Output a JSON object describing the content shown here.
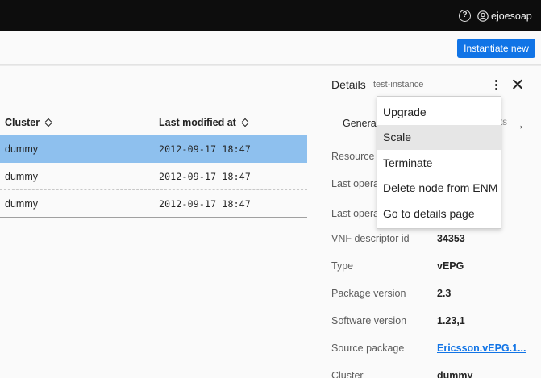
{
  "topbar": {
    "help_icon": "question-circle-icon",
    "user_icon": "user-icon",
    "username": "ejoesoap"
  },
  "actions": {
    "instantiate_label": "Instantiate new"
  },
  "table": {
    "columns": [
      {
        "label": "Cluster"
      },
      {
        "label": "Last modified at"
      }
    ],
    "rows": [
      {
        "cluster": "dummy",
        "modified": "2012-09-17 18:47",
        "selected": true
      },
      {
        "cluster": "dummy",
        "modified": "2012-09-17 18:47",
        "selected": false
      },
      {
        "cluster": "dummy",
        "modified": "2012-09-17 18:47",
        "selected": false
      }
    ]
  },
  "details": {
    "title": "Details",
    "subtitle": "test-instance",
    "tab_general": "Genera",
    "tab_partial": "ts",
    "fields": [
      {
        "label": "Resource i",
        "value": ""
      },
      {
        "label": "Last opera",
        "value": ""
      },
      {
        "label": "Last opera",
        "value": ""
      },
      {
        "label": "VNF descriptor id",
        "value": "34353"
      },
      {
        "label": "Type",
        "value": "vEPG"
      },
      {
        "label": "Package version",
        "value": "2.3"
      },
      {
        "label": "Software version",
        "value": "1.23,1"
      },
      {
        "label": "Source package",
        "value": "Ericsson.vEPG.1..."
      },
      {
        "label": "Cluster",
        "value": "dummy"
      }
    ]
  },
  "menu": {
    "items": [
      {
        "label": "Upgrade"
      },
      {
        "label": "Scale"
      },
      {
        "label": "Terminate"
      },
      {
        "label": "Delete node from ENM"
      },
      {
        "label": "Go to details page"
      }
    ]
  }
}
